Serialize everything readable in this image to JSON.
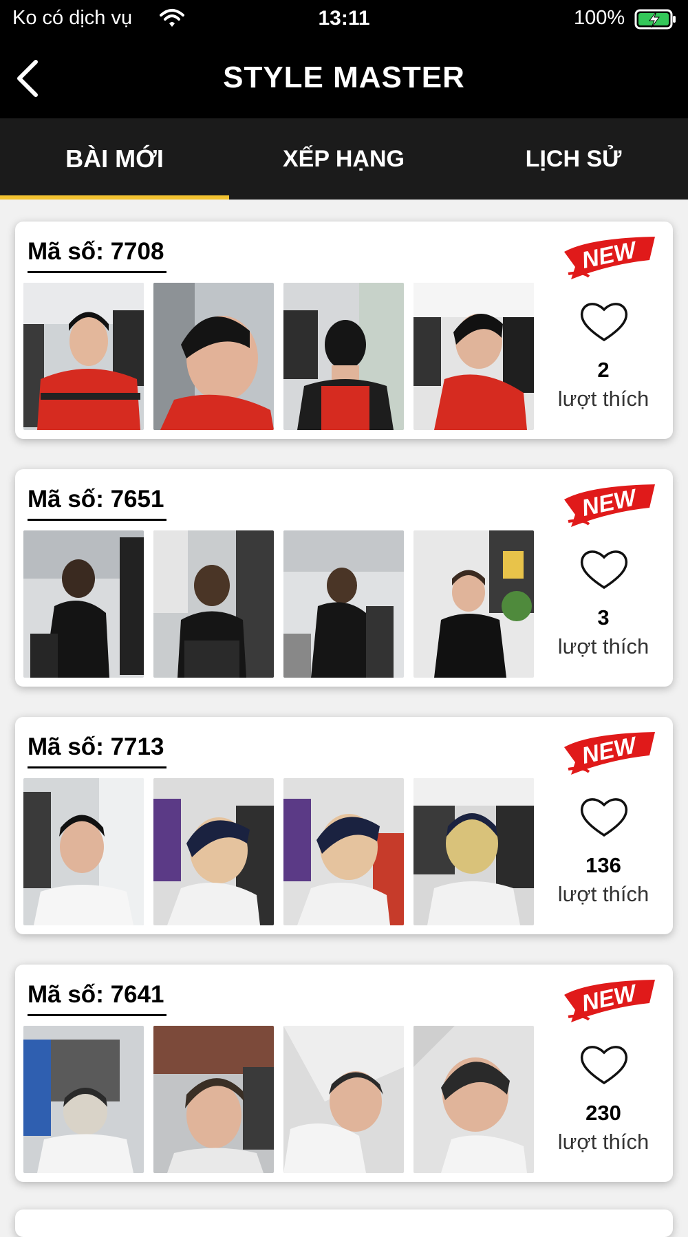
{
  "status_bar": {
    "carrier": "Ko có dịch vụ",
    "time": "13:11",
    "battery": "100%"
  },
  "nav": {
    "title": "STYLE MASTER"
  },
  "tabs": [
    {
      "label": "BÀI MỚI",
      "active": true
    },
    {
      "label": "XẾP HẠNG",
      "active": false
    },
    {
      "label": "LỊCH SỬ",
      "active": false
    }
  ],
  "accent_color": "#f2c230",
  "badge_color": "#e01a1a",
  "posts": [
    {
      "code": "Mã số: 7708",
      "badge": "NEW",
      "likes": "2",
      "likes_label": "lượt thích"
    },
    {
      "code": "Mã số: 7651",
      "badge": "NEW",
      "likes": "3",
      "likes_label": "lượt thích"
    },
    {
      "code": "Mã số: 7713",
      "badge": "NEW",
      "likes": "136",
      "likes_label": "lượt thích"
    },
    {
      "code": "Mã số: 7641",
      "badge": "NEW",
      "likes": "230",
      "likes_label": "lượt thích"
    }
  ]
}
